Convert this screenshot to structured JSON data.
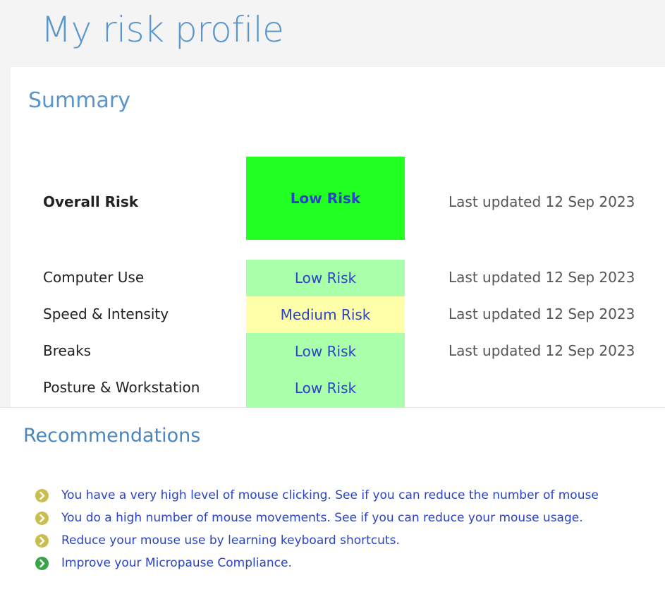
{
  "page": {
    "title": "My risk profile"
  },
  "summary": {
    "heading": "Summary",
    "overall": {
      "label": "Overall Risk",
      "risk": "Low Risk",
      "updated": "Last updated 12 Sep 2023",
      "color": "#22ff22"
    },
    "rows": [
      {
        "label": "Computer Use",
        "risk": "Low Risk",
        "updated": "Last updated 12 Sep 2023",
        "color": "#aaffaa"
      },
      {
        "label": "Speed & Intensity",
        "risk": "Medium Risk",
        "updated": "Last updated 12 Sep 2023",
        "color": "#ffffaa"
      },
      {
        "label": "Breaks",
        "risk": "Low Risk",
        "updated": "Last updated 12 Sep 2023",
        "color": "#aaffaa"
      },
      {
        "label": "Posture & Workstation",
        "risk": "Low Risk",
        "updated": "",
        "color": "#aaffaa"
      }
    ]
  },
  "recommendations": {
    "heading": "Recommendations",
    "items": [
      {
        "text": "You have a very high level of mouse clicking. See if you can reduce the number of mouse",
        "icon": "chevron-right-circle-icon",
        "icon_color": "#c8bd4e"
      },
      {
        "text": "You do a high number of mouse movements. See if you can reduce your mouse usage.",
        "icon": "chevron-right-circle-icon",
        "icon_color": "#c8bd4e"
      },
      {
        "text": "Reduce your mouse use by learning keyboard shortcuts.",
        "icon": "chevron-right-circle-icon",
        "icon_color": "#c8bd4e"
      },
      {
        "text": "Improve your Micropause Compliance.",
        "icon": "chevron-right-circle-icon",
        "icon_color": "#3aa34a"
      }
    ]
  }
}
